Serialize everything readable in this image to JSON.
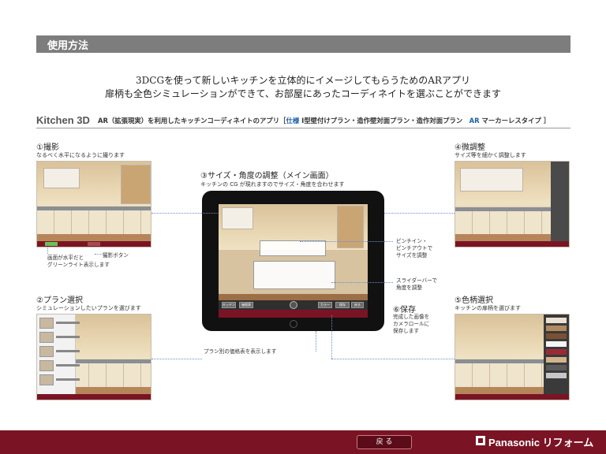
{
  "header": {
    "title": "使用方法"
  },
  "intro": {
    "line1": "3DCGを使って新しいキッチンを立体的にイメージしてもらうためのARアプリ",
    "line2": "扉柄も全色シミュレーションができて、お部屋にあったコーディネイトを選ぶことができます"
  },
  "kitchen3d": {
    "title": "Kitchen 3D",
    "desc_prefix": "AR（拡張現実）を利用したキッチンコーディネイトのアプリ［",
    "spec_label": "仕様",
    "spec_text": "I型壁付けプラン・造作壁対面プラン・造作対面プラン",
    "ar_label": "AR",
    "ar_text": "マーカーレスタイプ ］"
  },
  "sections": {
    "shoot": {
      "title": "①撮影",
      "sub": "なるべく水平になるように撮ります",
      "note_level": "画面が水平だと\nグリーンライト表示します",
      "note_button": "撮影ボタン"
    },
    "plan": {
      "title": "②プラン選択",
      "sub": "シミュレーションしたいプランを選びます"
    },
    "main": {
      "title": "③サイズ・角度の調整（メイン画面）",
      "sub": "キッチンの CG が現れますのでサイズ・角度を合わせます",
      "note_pinch": "ピンチイン・\nピンチアウトで\nサイズを調整",
      "note_slider": "スライダーバーで\n角度を調整",
      "note_price": "プラン別の価格表を表示します"
    },
    "fine": {
      "title": "④微調整",
      "sub": "サイズ等を細かく調整します"
    },
    "save": {
      "title": "⑥保存",
      "note": "完成した画像を\nカメラロールに\n保存します"
    },
    "color": {
      "title": "⑤色柄選択",
      "sub": "キッチンの扉柄を選びます"
    }
  },
  "ipad_controls": {
    "btn1": "キッチン",
    "btn2": "価格表",
    "btn3": "カラー",
    "btn4": "保存",
    "btn5": "戻る"
  },
  "footer": {
    "back_label": "戻 る",
    "brand": "Panasonic リフォーム"
  },
  "colors": {
    "accent_red": "#7a1424",
    "header_gray": "#7d7d7d",
    "blue": "#1d5fa8"
  }
}
